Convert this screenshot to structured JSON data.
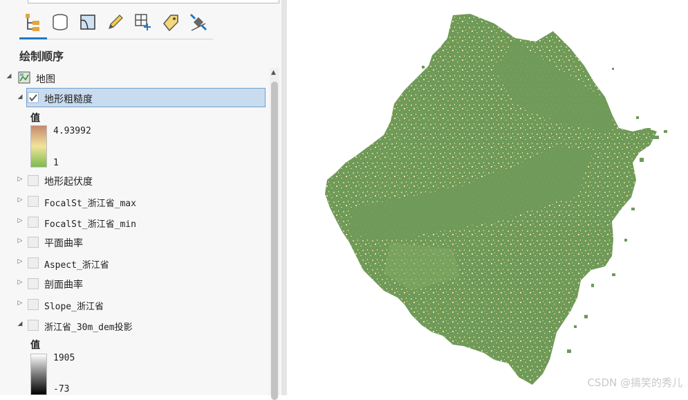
{
  "toc": {
    "tabs": [
      {
        "name": "list-by-drawing-order-icon"
      },
      {
        "name": "list-by-data-source-icon"
      },
      {
        "name": "list-by-selection-icon"
      },
      {
        "name": "list-by-editing-icon"
      },
      {
        "name": "list-by-snapping-icon"
      },
      {
        "name": "list-by-labeling-icon"
      },
      {
        "name": "list-by-perspective-imagery-icon"
      }
    ],
    "heading": "绘制顺序",
    "map_label": "地图",
    "layers": [
      {
        "label": "地形粗糙度",
        "checked": true,
        "expanded": true,
        "selected": true,
        "legend": {
          "title": "值",
          "high": "4.93992",
          "low": "1"
        }
      },
      {
        "label": "地形起伏度",
        "checked": false,
        "expanded": false
      },
      {
        "label": "FocalSt_浙江省_max",
        "checked": false,
        "expanded": false
      },
      {
        "label": "FocalSt_浙江省_min",
        "checked": false,
        "expanded": false
      },
      {
        "label": "平面曲率",
        "checked": false,
        "expanded": false
      },
      {
        "label": "Aspect_浙江省",
        "checked": false,
        "expanded": false
      },
      {
        "label": "剖面曲率",
        "checked": false,
        "expanded": false
      },
      {
        "label": "Slope_浙江省",
        "checked": false,
        "expanded": false
      },
      {
        "label": "浙江省_30m_dem投影",
        "checked": false,
        "expanded": true,
        "legend": {
          "title": "值",
          "high": "1905",
          "low": "-73"
        }
      }
    ]
  },
  "map": {
    "watermark": "CSDN @搞笑的秀儿",
    "colors": {
      "base": "#6f9a59",
      "speckle_light": "#e8e49a",
      "speckle_mid": "#b9c87a"
    }
  }
}
